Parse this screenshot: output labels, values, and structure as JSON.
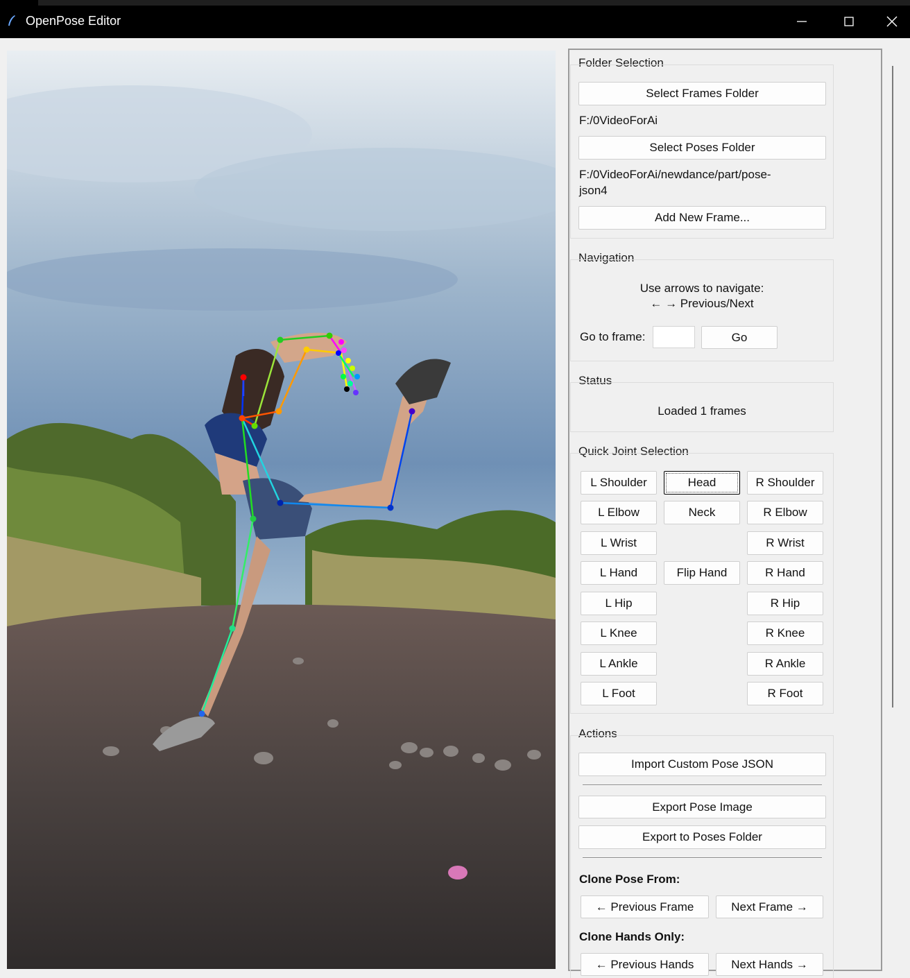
{
  "window": {
    "title": "OpenPose Editor"
  },
  "folder_selection": {
    "title": "Folder Selection",
    "select_frames_label": "Select Frames Folder",
    "frames_path": "F:/0VideoForAi",
    "select_poses_label": "Select Poses Folder",
    "poses_path_line1": "F:/0VideoForAi/newdance/part/pose-",
    "poses_path_line2": "json4",
    "add_frame_label": "Add New Frame..."
  },
  "navigation": {
    "title": "Navigation",
    "hint_line1": "Use arrows to navigate:",
    "hint_line2": "← → Previous/Next",
    "goto_label": "Go to frame:",
    "goto_value": "",
    "go_label": "Go"
  },
  "status": {
    "title": "Status",
    "message": "Loaded 1 frames"
  },
  "quick_joint": {
    "title": "Quick Joint Selection",
    "l_shoulder": "L Shoulder",
    "head": "Head",
    "r_shoulder": "R Shoulder",
    "l_elbow": "L Elbow",
    "neck": "Neck",
    "r_elbow": "R Elbow",
    "l_wrist": "L Wrist",
    "r_wrist": "R Wrist",
    "l_hand": "L Hand",
    "flip_hand": "Flip Hand",
    "r_hand": "R Hand",
    "l_hip": "L Hip",
    "r_hip": "R Hip",
    "l_knee": "L Knee",
    "r_knee": "R Knee",
    "l_ankle": "L Ankle",
    "r_ankle": "R Ankle",
    "l_foot": "L Foot",
    "r_foot": "R Foot"
  },
  "actions": {
    "title": "Actions",
    "import_label": "Import Custom Pose JSON",
    "export_image_label": "Export Pose Image",
    "export_folder_label": "Export to Poses Folder",
    "clone_pose_heading": "Clone Pose From:",
    "prev_frame_label": "← Previous Frame",
    "next_frame_label": "Next Frame →",
    "clone_hands_heading": "Clone Hands Only:",
    "prev_hands_label": "← Previous Hands",
    "next_hands_label": "Next Hands →"
  },
  "icons": {
    "app": "feather-icon",
    "minimize": "minimize-icon",
    "maximize": "maximize-icon",
    "close": "close-icon"
  }
}
